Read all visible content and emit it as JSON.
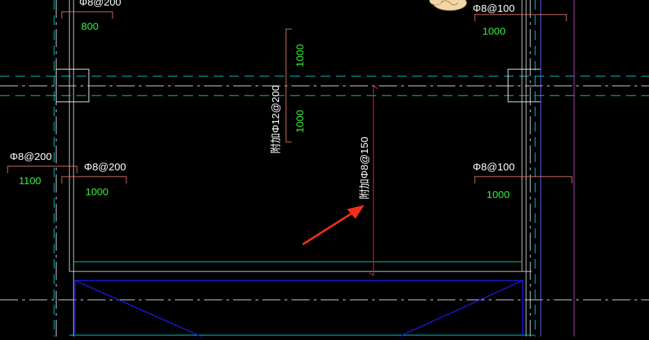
{
  "drawing": {
    "colors": {
      "background": "#000000",
      "axis": "#00d7d7",
      "wall": "#cfd6d6",
      "column": "#ffffff",
      "dim_line": "#e07a6a",
      "rebar_line": "#d62020",
      "text_white": "#ffffff",
      "text_green": "#33ee33",
      "magenta": "#c040c0",
      "blue": "#1a1aee",
      "arrow": "#f0301c"
    },
    "labels": {
      "top_left_spec": "Φ8@200",
      "top_left_len": "800",
      "top_right_spec": "Φ8@100",
      "top_right_len": "1000",
      "center_len_upper": "1000",
      "center_len_lower": "1000",
      "center_vertical_spec": "附加Φ12@200",
      "left_outer_spec": "Φ8@200",
      "left_outer_len": "1100",
      "left_inner_spec": "Φ8@200",
      "left_inner_len": "1000",
      "right_mid_spec": "Φ8@100",
      "right_mid_len": "1000",
      "added_rebar_spec": "附加Φ8@150"
    },
    "icons": {
      "top_badge": "decorative-cloud-icon",
      "annotation_arrow": "red-arrow-icon"
    }
  }
}
